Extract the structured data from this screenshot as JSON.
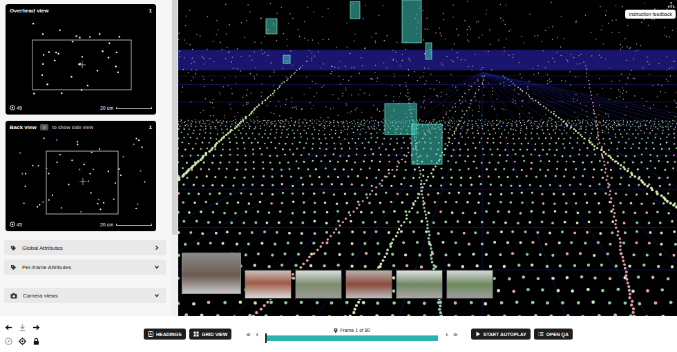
{
  "overhead_view": {
    "title": "Overhead view",
    "number": "1",
    "scale": "20 cm",
    "count": "45"
  },
  "back_view": {
    "title": "Back view",
    "key": "V",
    "hint": "to show side view",
    "number": "1",
    "scale": "20 cm",
    "count": "45"
  },
  "sections": [
    {
      "label": "Global Attributes",
      "expanded": false
    },
    {
      "label": "Per-frame Attributes",
      "expanded": true
    },
    {
      "label": "Camera views",
      "expanded": true
    }
  ],
  "instruction_feedback": "Instruction feedback",
  "camera_thumbnails": [
    {
      "selected": true
    },
    {
      "selected": false
    },
    {
      "selected": false
    },
    {
      "selected": false
    },
    {
      "selected": false
    },
    {
      "selected": false
    }
  ],
  "view_tools": [
    {
      "disabled": false
    },
    {
      "disabled": true
    },
    {
      "disabled": false
    },
    {
      "disabled": true
    },
    {
      "disabled": false
    },
    {
      "disabled": false
    }
  ],
  "view_buttons": [
    "HEADINGS",
    "GRID VIEW"
  ],
  "nav": {
    "first": "«",
    "prev": "‹",
    "next": "›",
    "last": "»"
  },
  "timeline": {
    "label": "Frame 1 of 80",
    "level": 0
  },
  "actions": [
    "START AUTOPLAY",
    "OPEN QA"
  ]
}
